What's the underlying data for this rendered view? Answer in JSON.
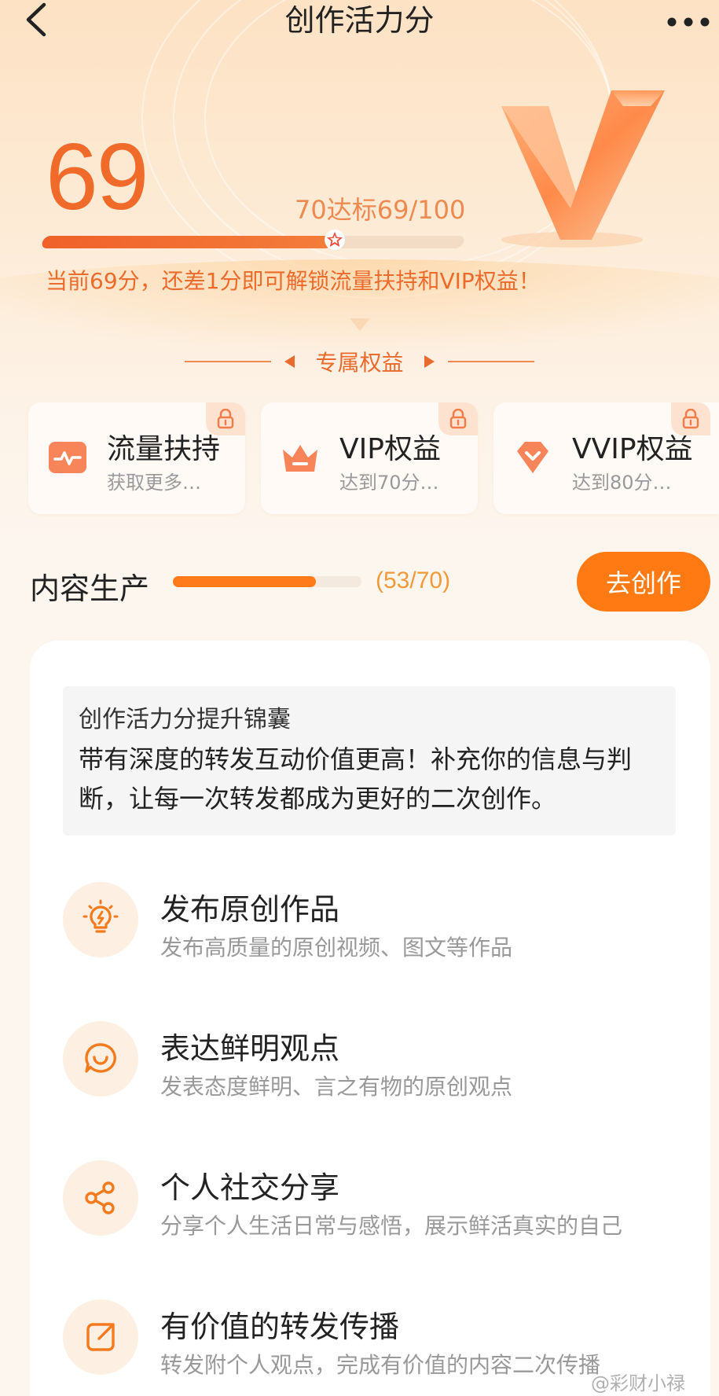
{
  "header": {
    "title": "创作活力分"
  },
  "score": {
    "value": "69",
    "target_text": "70达标69/100",
    "progress": 0.69,
    "hint": "当前69分，还差1分即可解锁流量扶持和VIP权益！"
  },
  "benefits_section": {
    "title": "专属权益",
    "items": [
      {
        "title": "流量扶持",
        "subtitle": "获取更多…",
        "icon": "traffic-icon",
        "locked": true
      },
      {
        "title": "VIP权益",
        "subtitle": "达到70分…",
        "icon": "crown-icon",
        "locked": true
      },
      {
        "title": "VVIP权益",
        "subtitle": "达到80分…",
        "icon": "diamond-icon",
        "locked": true
      }
    ]
  },
  "content_production": {
    "label": "内容生产",
    "count": "(53/70)",
    "progress": 0.757,
    "button": "去创作"
  },
  "tips": {
    "title": "创作活力分提升锦囊",
    "body": "带有深度的转发互动价值更高！补充你的信息与判断，让每一次转发都成为更好的二次创作。"
  },
  "tasks": [
    {
      "title": "发布原创作品",
      "desc": "发布高质量的原创视频、图文等作品",
      "icon": "lightbulb-icon"
    },
    {
      "title": "表达鲜明观点",
      "desc": "发表态度鲜明、言之有物的原创观点",
      "icon": "speech-bubble-icon"
    },
    {
      "title": "个人社交分享",
      "desc": "分享个人生活日常与感悟，展示鲜活真实的自己",
      "icon": "share-icon"
    },
    {
      "title": "有价值的转发传播",
      "desc": "转发附个人观点，完成有价值的内容二次传播",
      "icon": "repost-icon"
    }
  ],
  "watermark": "@彩财小禄",
  "colors": {
    "accent": "#f06a2a",
    "button": "#ff7a12",
    "progress_track": "#f3dcc6"
  }
}
